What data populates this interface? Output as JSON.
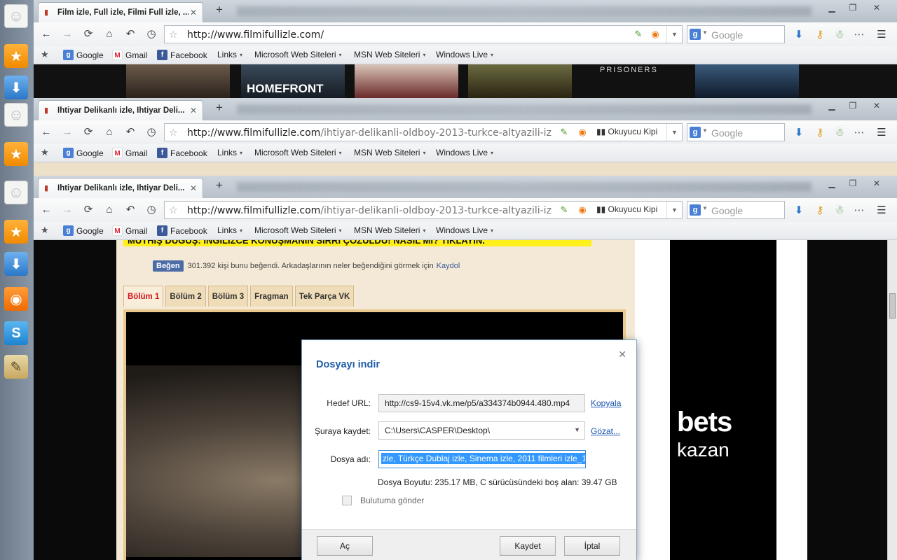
{
  "dock": {
    "icons": [
      "smile-icon",
      "star-icon",
      "download-icon",
      "smile-icon",
      "star-icon",
      "smile-icon",
      "star-icon",
      "download-icon",
      "rss-icon",
      "skype-icon",
      "notes-icon"
    ]
  },
  "windows": [
    {
      "tab_title": "Film izle, Full izle, Filmi Full izle, ...",
      "url_host": "http://www.filmifullizle.com/",
      "url_path": "",
      "reader": ""
    },
    {
      "tab_title": "İhtiyar Delikanlı izle, İhtiyar Deli...",
      "url_host": "http://www.filmifullizle.com",
      "url_path": "/ihtiyar-delikanli-oldboy-2013-turkce-altyazili-izle.h",
      "reader": "Okuyucu Kipi"
    },
    {
      "tab_title": "İhtiyar Delikanlı izle, İhtiyar Deli...",
      "url_host": "http://www.filmifullizle.com",
      "url_path": "/ihtiyar-delikanli-oldboy-2013-turkce-altyazili-izle.h",
      "reader": "Okuyucu Kipi"
    }
  ],
  "search": {
    "placeholder": "Google"
  },
  "bookmarks": {
    "google": "Google",
    "gmail": "Gmail",
    "facebook": "Facebook",
    "links": "Links",
    "microsoft": "Microsoft Web Siteleri",
    "msn": "MSN Web Siteleri",
    "windows_live": "Windows Live"
  },
  "posters": [
    "",
    "HOMEFRONT",
    "",
    "",
    "PRISONERS",
    ""
  ],
  "page": {
    "banner": "MÜTHİŞ DÜĞÜŞ: İNGİLİZCE KONUŞMANIN SIRRI ÇÖZÜLDÜ! NASIL MI? TIKLAYIN.",
    "fb_like_label": "Beğen",
    "fb_like_text": "301.392 kişi bunu beğendi. Arkadaşlarının neler beğendiğini görmek için",
    "fb_signup": "Kaydol",
    "tabs": [
      "Bölüm 1",
      "Bölüm 2",
      "Bölüm 3",
      "Fragman",
      "Tek Parça VK"
    ],
    "ad_line1": "bets",
    "ad_line2": "kazan"
  },
  "dialog": {
    "title": "Dosyayı indir",
    "target_url_label": "Hedef URL:",
    "target_url": "http://cs9-15v4.vk.me/p5/a334374b0944.480.mp4",
    "copy_link": "Kopyala",
    "save_to_label": "Şuraya kaydet:",
    "save_to": "C:\\Users\\CASPER\\Desktop\\",
    "browse_link": "Gözat...",
    "file_name_label": "Dosya adı:",
    "file_name": "zle, Türkçe Dublaj izle, Sinema izle, 2011 filmleri izle_1",
    "info": "Dosya Boyutu: 235.17 MB, C sürücüsündeki boş alan: 39.47 GB",
    "cloud_label": "Bulutuma gönder",
    "open_button": "Aç",
    "save_button": "Kaydet",
    "cancel_button": "İptal"
  }
}
